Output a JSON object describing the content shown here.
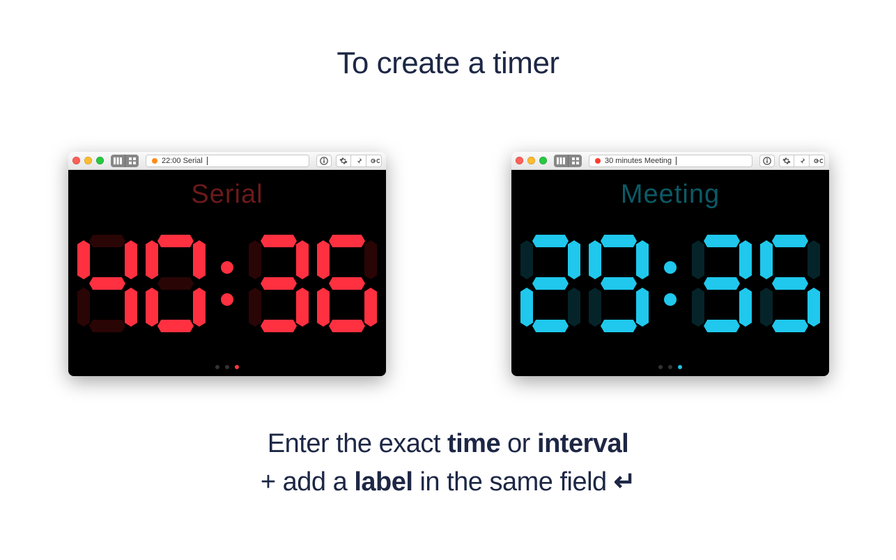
{
  "headline": "To create a timer",
  "instruction_line1_a": "Enter the exact ",
  "instruction_line1_b": "time",
  "instruction_line1_c": " or ",
  "instruction_line1_d": "interval",
  "instruction_line2_a": "+ add a ",
  "instruction_line2_b": "label",
  "instruction_line2_c": " in the same field ",
  "left_window": {
    "input_text": "22:00 Serial",
    "status_color": "orange",
    "body_label": "Serial",
    "digits": [
      "4",
      "0",
      "3",
      "6"
    ],
    "accent": "red",
    "active_page_index": 2
  },
  "right_window": {
    "input_text": "30 minutes Meeting",
    "status_color": "red",
    "body_label": "Meeting",
    "digits": [
      "2",
      "9",
      "3",
      "5"
    ],
    "accent": "cyan",
    "active_page_index": 2
  },
  "icons": {
    "columns": "columns-icon",
    "grid": "grid-icon",
    "info": "info-icon",
    "gear": "gear-icon",
    "pin": "pin-icon",
    "loop": "loop-icon"
  }
}
